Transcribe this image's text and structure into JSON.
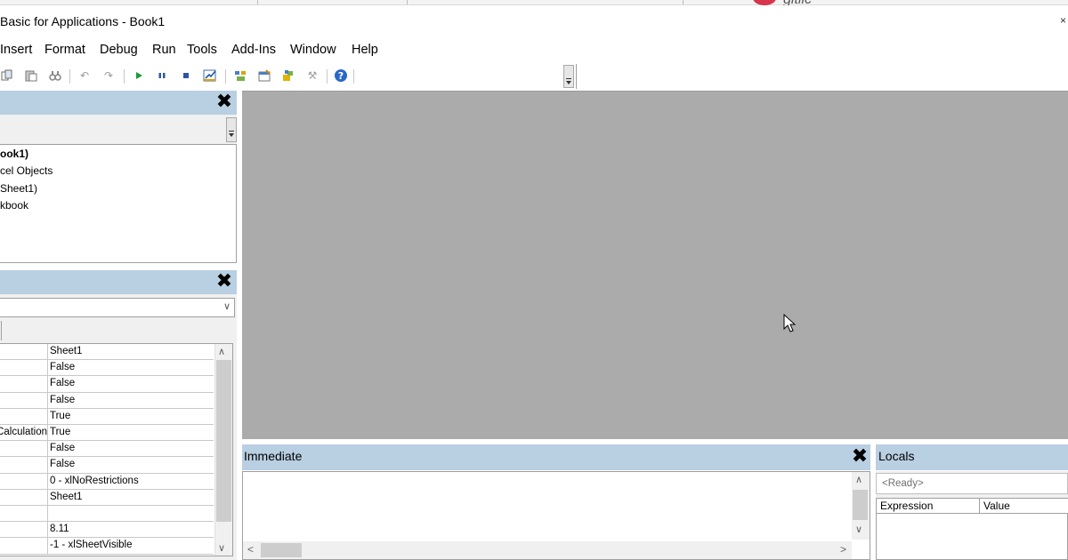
{
  "window": {
    "title": "Basic for Applications - Book1",
    "close_glyph": "×"
  },
  "background": {
    "git_label": "gitlic"
  },
  "menu": {
    "items": [
      {
        "label": "Insert"
      },
      {
        "label": "Format"
      },
      {
        "label": "Debug"
      },
      {
        "label": "Run"
      },
      {
        "label": "Tools"
      },
      {
        "label": "Add-Ins"
      },
      {
        "label": "Window"
      },
      {
        "label": "Help"
      }
    ]
  },
  "toolbar": {
    "icons": [
      "copy-icon",
      "paste-icon",
      "find-icon",
      "undo-icon",
      "redo-icon",
      "run-icon",
      "break-icon",
      "reset-icon",
      "design-mode-icon",
      "project-explorer-icon",
      "properties-icon",
      "object-browser-icon",
      "toolbox-icon",
      "help-icon"
    ],
    "location_value": ""
  },
  "project_pane": {
    "close_glyph": "✕",
    "tree": [
      {
        "label": "ook1)",
        "bold": true
      },
      {
        "label": "cel Objects",
        "bold": false
      },
      {
        "label": "Sheet1)",
        "bold": false
      },
      {
        "label": "kbook",
        "bold": false
      }
    ]
  },
  "properties_pane": {
    "close_glyph": "✕",
    "object_value": "",
    "rows": [
      {
        "key": "",
        "value": "Sheet1"
      },
      {
        "key": "",
        "value": "False"
      },
      {
        "key": "",
        "value": "False"
      },
      {
        "key": "",
        "value": "False"
      },
      {
        "key": "",
        "value": "True"
      },
      {
        "key": "Calculation",
        "value": "True"
      },
      {
        "key": "",
        "value": "False"
      },
      {
        "key": "",
        "value": "False"
      },
      {
        "key": "",
        "value": "0 - xlNoRestrictions"
      },
      {
        "key": "",
        "value": "Sheet1"
      },
      {
        "key": "",
        "value": ""
      },
      {
        "key": "",
        "value": "8.11"
      },
      {
        "key": "",
        "value": "-1 - xlSheetVisible"
      }
    ]
  },
  "immediate": {
    "title": "Immediate",
    "close_glyph": "✕",
    "content": ""
  },
  "locals": {
    "title": "Locals",
    "status": "<Ready>",
    "columns": [
      "Expression",
      "Value"
    ]
  },
  "colors": {
    "pane_header": "#b9cfe2",
    "code_background": "#ababab",
    "git_brand": "#d7354b"
  }
}
